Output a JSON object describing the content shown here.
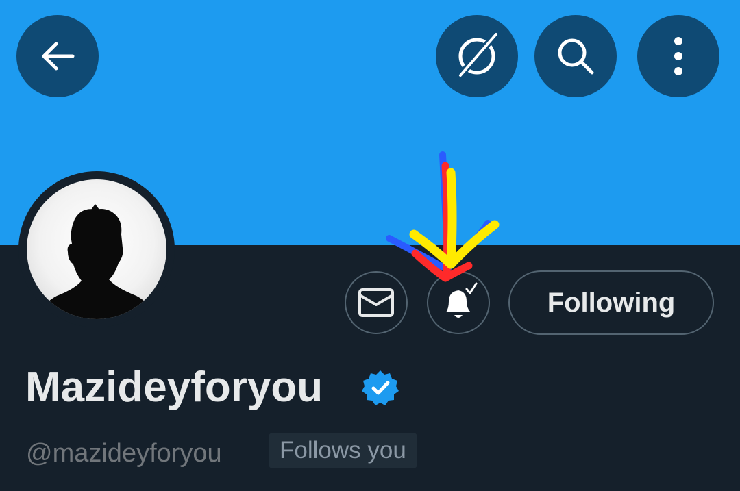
{
  "header": {
    "back_icon": "arrow-left-icon",
    "grok_icon": "grok-icon",
    "search_icon": "search-icon",
    "more_icon": "more-vertical-icon"
  },
  "profile": {
    "display_name": "Mazideyforyou",
    "handle": "@mazideyforyou",
    "follows_you_label": "Follows you",
    "verified": true
  },
  "actions": {
    "message_icon": "envelope-icon",
    "notifications_icon": "bell-check-icon",
    "following_label": "Following"
  },
  "colors": {
    "banner": "#1d9bf0",
    "background": "#15202b",
    "header_button": "#0f4a74",
    "verified_badge": "#1d9bf0"
  }
}
